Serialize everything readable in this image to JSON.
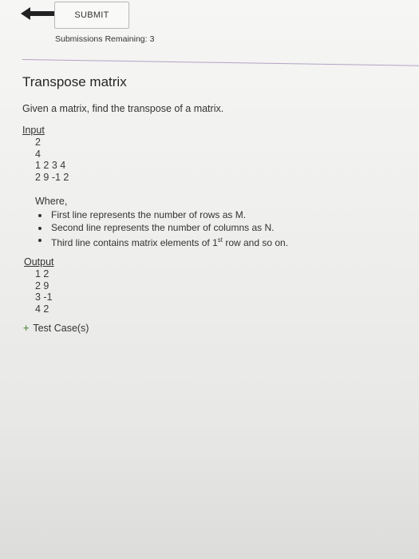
{
  "toolbar": {
    "back_icon": "arrow-left-icon",
    "submit_label": "SUBMIT",
    "remaining_label": "Submissions Remaining:",
    "remaining_count": "3"
  },
  "problem": {
    "title": "Transpose matrix",
    "description": "Given a matrix, find the transpose of a matrix.",
    "input_label": "Input",
    "input_lines": [
      "2",
      "4",
      "1 2 3 4",
      "2 9 -1 2"
    ],
    "where_label": "Where,",
    "bullets": [
      {
        "text": "First line represents the number of rows as M."
      },
      {
        "text": "Second line represents the number of columns as N."
      },
      {
        "pre": "Third line contains matrix elements of 1",
        "sup": "st",
        "post": " row and so on."
      }
    ],
    "output_label": "Output",
    "output_lines": [
      "1 2",
      "2 9",
      "3 -1",
      "4 2"
    ],
    "testcase_icon": "plus-icon",
    "testcase_label": "Test Case(s)"
  },
  "colors": {
    "divider": "#b2a2c4",
    "plus": "#6c9a57"
  }
}
